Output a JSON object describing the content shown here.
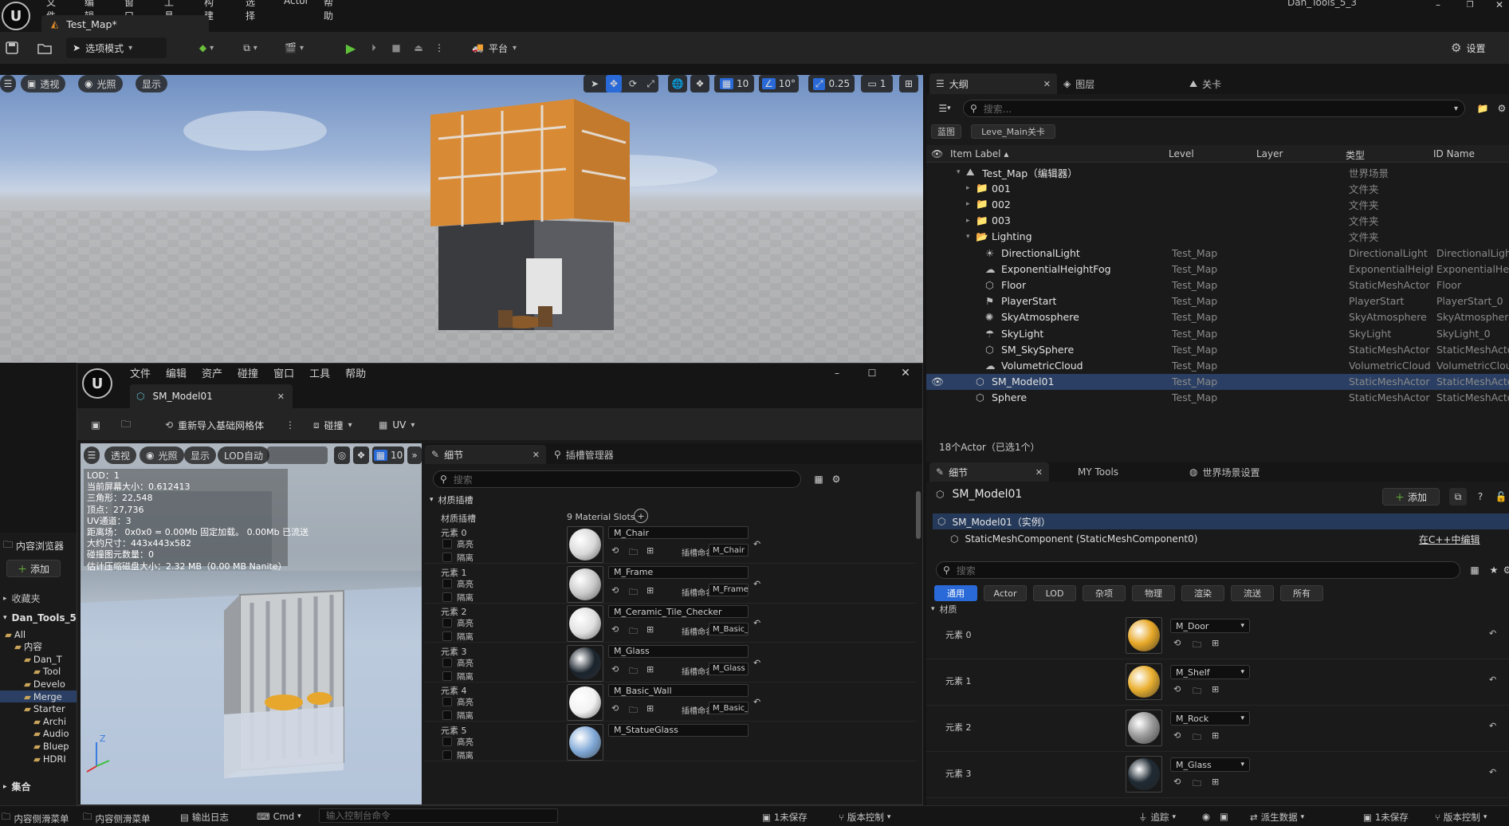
{
  "menu": [
    "文件",
    "编辑",
    "窗口",
    "工具",
    "构建",
    "选择",
    "Actor",
    "帮助"
  ],
  "project_name": "Dan_Tools_5_3",
  "tab_title": "Test_Map*",
  "toolbar": {
    "mode_label": "选项模式",
    "platform_label": "平台",
    "settings_label": "设置"
  },
  "viewport": {
    "perspective": "透视",
    "lit": "光照",
    "show": "显示",
    "grid_value": "10",
    "angle_value": "10°",
    "scale_value": "0.25",
    "camera_speed": "1"
  },
  "outliner": {
    "tabs": [
      "大纲",
      "图层",
      "关卡"
    ],
    "search_placeholder": "搜索...",
    "filter_chips": [
      "蓝图",
      "Leve_Main关卡"
    ],
    "columns": [
      "Item Label",
      "Level",
      "Layer",
      "类型",
      "ID Name"
    ],
    "rows": [
      {
        "label": "Test_Map（编辑器）",
        "level": "",
        "type": "世界场景",
        "id": "",
        "depth": 1,
        "icon": "map-icon",
        "expanded": true
      },
      {
        "label": "001",
        "level": "",
        "type": "文件夹",
        "id": "",
        "depth": 2,
        "icon": "folder-icon",
        "expanded": false
      },
      {
        "label": "002",
        "level": "",
        "type": "文件夹",
        "id": "",
        "depth": 2,
        "icon": "folder-icon",
        "expanded": false
      },
      {
        "label": "003",
        "level": "",
        "type": "文件夹",
        "id": "",
        "depth": 2,
        "icon": "folder-icon",
        "expanded": false
      },
      {
        "label": "Lighting",
        "level": "",
        "type": "文件夹",
        "id": "",
        "depth": 2,
        "icon": "folder-open-icon",
        "expanded": true
      },
      {
        "label": "DirectionalLight",
        "level": "Test_Map",
        "type": "DirectionalLight",
        "id": "DirectionalLight",
        "depth": 3,
        "icon": "sun-icon"
      },
      {
        "label": "ExponentialHeightFog",
        "level": "Test_Map",
        "type": "ExponentialHeight",
        "id": "ExponentialHeig",
        "depth": 3,
        "icon": "fog-icon"
      },
      {
        "label": "Floor",
        "level": "Test_Map",
        "type": "StaticMeshActor",
        "id": "Floor",
        "depth": 3,
        "icon": "mesh-icon"
      },
      {
        "label": "PlayerStart",
        "level": "Test_Map",
        "type": "PlayerStart",
        "id": "PlayerStart_0",
        "depth": 3,
        "icon": "flag-icon"
      },
      {
        "label": "SkyAtmosphere",
        "level": "Test_Map",
        "type": "SkyAtmosphere",
        "id": "SkyAtmosphere",
        "depth": 3,
        "icon": "sky-icon"
      },
      {
        "label": "SkyLight",
        "level": "Test_Map",
        "type": "SkyLight",
        "id": "SkyLight_0",
        "depth": 3,
        "icon": "skylight-icon"
      },
      {
        "label": "SM_SkySphere",
        "level": "Test_Map",
        "type": "StaticMeshActor",
        "id": "StaticMeshActo",
        "depth": 3,
        "icon": "mesh-icon"
      },
      {
        "label": "VolumetricCloud",
        "level": "Test_Map",
        "type": "VolumetricCloud",
        "id": "VolumetricClou",
        "depth": 3,
        "icon": "cloud-icon"
      },
      {
        "label": "SM_Model01",
        "level": "Test_Map",
        "type": "StaticMeshActor",
        "id": "StaticMeshActo",
        "depth": 2,
        "icon": "mesh-icon",
        "selected": true
      },
      {
        "label": "Sphere",
        "level": "Test_Map",
        "type": "StaticMeshActor",
        "id": "StaticMeshActo",
        "depth": 2,
        "icon": "mesh-icon"
      }
    ],
    "footer": "18个Actor（已选1个）"
  },
  "details": {
    "tabs": [
      "细节",
      "MY Tools",
      "世界场景设置"
    ],
    "actor_name": "SM_Model01",
    "add_label": "添加",
    "instance_label": "SM_Model01（实例）",
    "component_label": "StaticMeshComponent (StaticMeshComponent0)",
    "cpp_link": "在C++中编辑",
    "search_placeholder": "搜索",
    "filters": [
      "通用",
      "Actor",
      "LOD",
      "杂项",
      "物理",
      "渲染",
      "流送",
      "所有"
    ],
    "section": "材质",
    "elements": [
      {
        "label": "元素 0",
        "material": "M_Door",
        "color": "#e8a928"
      },
      {
        "label": "元素 1",
        "material": "M_Shelf",
        "color": "#eab030"
      },
      {
        "label": "元素 2",
        "material": "M_Rock",
        "color": "#9a9a9a"
      },
      {
        "label": "元素 3",
        "material": "M_Glass",
        "color": "#1f2a33"
      }
    ]
  },
  "content_browser": {
    "title": "内容浏览器",
    "add_label": "添加",
    "favorites": "收藏夹",
    "project": "Dan_Tools_5",
    "tree": [
      "All",
      "内容",
      "Dan_T",
      "Tool",
      "Develo",
      "Merge",
      "Starter",
      "Archi",
      "Audio",
      "Bluep",
      "HDRI"
    ],
    "collections": "集合"
  },
  "editor": {
    "menu": [
      "文件",
      "编辑",
      "资产",
      "碰撞",
      "窗口",
      "工具",
      "帮助"
    ],
    "tab": "SM_Model01",
    "toolbar": {
      "reimport": "重新导入基础网格体",
      "collision": "碰撞",
      "uv": "UV"
    },
    "viewport": {
      "perspective": "透视",
      "lit": "光照",
      "show": "显示",
      "lod": "LOD自动",
      "grid": "10"
    },
    "stats": [
      "LOD：1",
      "当前屏幕大小：0.612413",
      "三角形：22,548",
      "顶点：27,736",
      "UV通道：3",
      "距离场： 0x0x0 = 0.00Mb 固定加载。 0.00Mb 已流送",
      "大约尺寸：443x443x582",
      "碰撞图元数量：0",
      "估计压缩磁盘大小：2.32 MB（0.00 MB Nanite）"
    ],
    "details_tab": "细节",
    "socket_tab": "插槽管理器",
    "search_placeholder": "搜索",
    "section": "材质插槽",
    "slots_label": "材质插槽",
    "slots_count": "9 Material Slots",
    "highlight": "高亮",
    "isolate": "隔离",
    "slot_name_label": "插槽命名",
    "slots": [
      {
        "label": "元素 0",
        "material": "M_Chair",
        "slot": "M_Chair",
        "color": "#d8d8d8"
      },
      {
        "label": "元素 1",
        "material": "M_Frame",
        "slot": "M_Frame",
        "color": "#c8c8c8"
      },
      {
        "label": "元素 2",
        "material": "M_Ceramic_Tile_Checker",
        "slot": "M_Basic_I",
        "color": "#e0e0e0"
      },
      {
        "label": "元素 3",
        "material": "M_Glass",
        "slot": "M_Glass",
        "color": "#1a232c"
      },
      {
        "label": "元素 4",
        "material": "M_Basic_Wall",
        "slot": "M_Basic_V",
        "color": "#f2f2f2"
      },
      {
        "label": "元素 5",
        "material": "M_StatueGlass",
        "slot": "",
        "color": "#7fa8d6"
      }
    ]
  },
  "statusbar": {
    "left": [
      "内容侧滑菜单",
      "内容侧滑菜单",
      "输出日志",
      "Cmd"
    ],
    "console_placeholder": "输入控制台命令",
    "unsaved": "1未保存",
    "source_control": "版本控制",
    "trace": "追踪",
    "derived": "派生数据",
    "unsaved_right": "1未保存",
    "source_control_right": "版本控制"
  }
}
